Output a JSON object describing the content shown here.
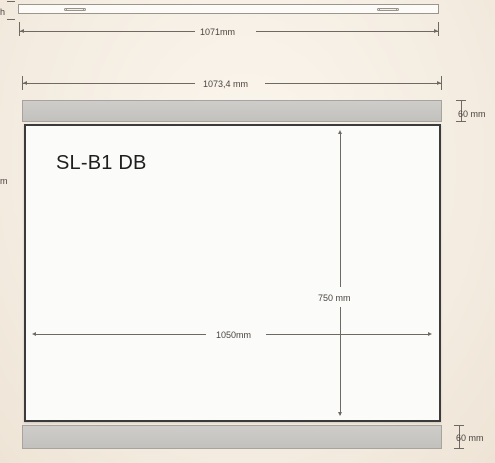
{
  "diagram": {
    "product_name": "SL-B1 DB",
    "dimensions": {
      "rail_length": "1071mm",
      "overall_width": "1073,4 mm",
      "panel_width": "1050mm",
      "panel_height": "750 mm",
      "header_rail_height": "60 mm",
      "footer_rail_height": "60 mm"
    },
    "cropped_labels": {
      "top_left": "h",
      "mid_left": "m"
    }
  }
}
